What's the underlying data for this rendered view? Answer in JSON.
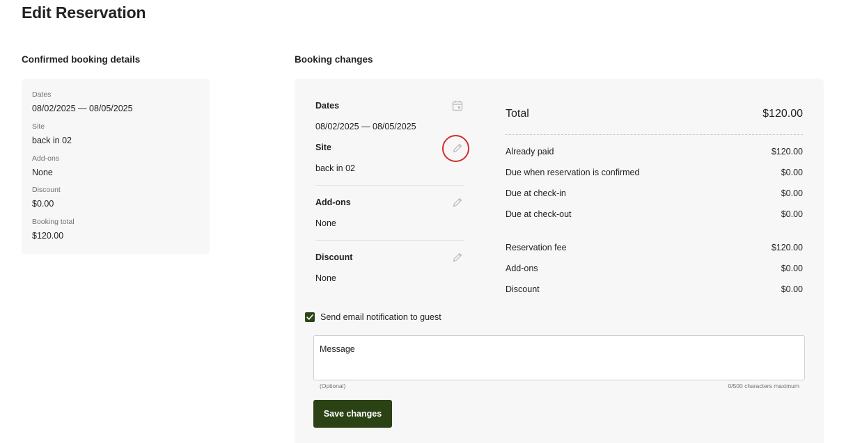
{
  "page": {
    "title": "Edit Reservation"
  },
  "confirmed": {
    "title": "Confirmed booking details",
    "fields": [
      {
        "label": "Dates",
        "value": "08/02/2025 — 08/05/2025"
      },
      {
        "label": "Site",
        "value": "back in 02"
      },
      {
        "label": "Add-ons",
        "value": "None"
      },
      {
        "label": "Discount",
        "value": "$0.00"
      },
      {
        "label": "Booking total",
        "value": "$120.00"
      }
    ]
  },
  "changes": {
    "title": "Booking changes",
    "dates": {
      "label": "Dates",
      "value": "08/02/2025 — 08/05/2025",
      "icon": "calendar-icon"
    },
    "site": {
      "label": "Site",
      "value": "back in 02",
      "icon": "pencil-icon"
    },
    "addons": {
      "label": "Add-ons",
      "value": "None",
      "icon": "pencil-icon"
    },
    "discount": {
      "label": "Discount",
      "value": "None",
      "icon": "pencil-icon"
    }
  },
  "summary": {
    "total_label": "Total",
    "total_value": "$120.00",
    "payments": [
      {
        "label": "Already paid",
        "value": "$120.00"
      },
      {
        "label": "Due when reservation is confirmed",
        "value": "$0.00"
      },
      {
        "label": "Due at check-in",
        "value": "$0.00"
      },
      {
        "label": "Due at check-out",
        "value": "$0.00"
      }
    ],
    "breakdown": [
      {
        "label": "Reservation fee",
        "value": "$120.00"
      },
      {
        "label": "Add-ons",
        "value": "$0.00"
      },
      {
        "label": "Discount",
        "value": "$0.00"
      }
    ]
  },
  "notification": {
    "checkbox_label": "Send email notification to guest",
    "checked": true,
    "message_placeholder": "Message",
    "optional_hint": "(Optional)",
    "char_limit": "0/500 characters maximum"
  },
  "actions": {
    "save_label": "Save changes"
  },
  "colors": {
    "primary": "#2b4215",
    "highlight": "#d62c2c",
    "card_bg": "#f7f7f7"
  }
}
